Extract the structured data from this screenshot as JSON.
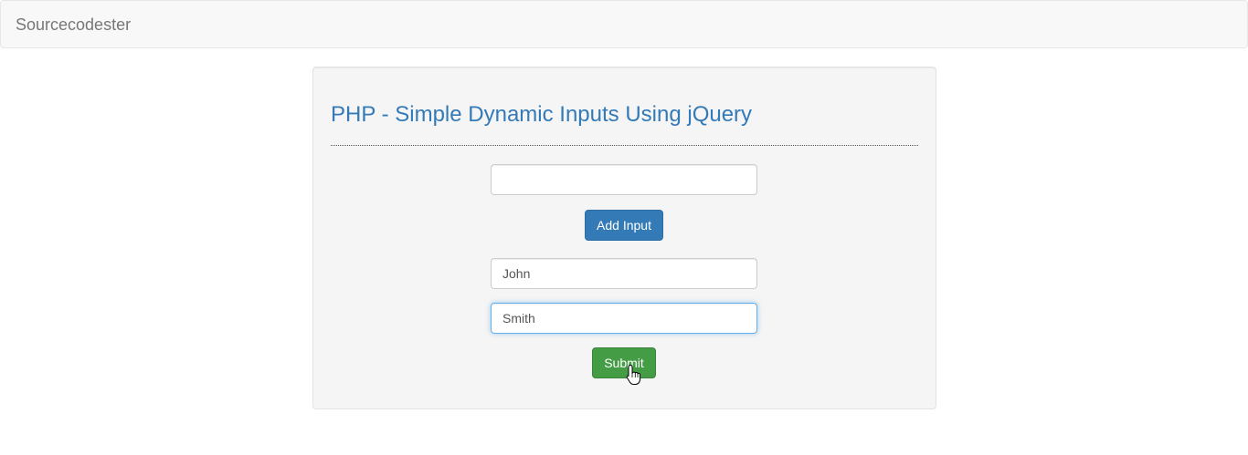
{
  "navbar": {
    "brand": "Sourcecodester"
  },
  "main": {
    "title": "PHP - Simple Dynamic Inputs Using jQuery",
    "new_input": {
      "value": "",
      "placeholder": ""
    },
    "add_input_label": "Add Input",
    "inputs": [
      {
        "value": "John"
      },
      {
        "value": "Smith"
      }
    ],
    "submit_label": "Submit"
  },
  "colors": {
    "primary": "#337ab7",
    "success": "#449d44",
    "title": "#337ab7"
  },
  "icons": {
    "cursor": "hand-pointer-icon"
  }
}
